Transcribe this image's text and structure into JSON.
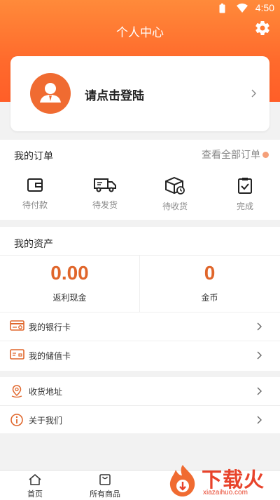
{
  "status_bar": {
    "time": "4:50"
  },
  "header": {
    "title": "个人中心",
    "settings_icon": "gear-icon"
  },
  "login_card": {
    "prompt": "请点击登陆",
    "avatar_icon": "user-avatar-icon",
    "chevron_icon": "chevron-right-icon"
  },
  "orders": {
    "title": "我的订单",
    "view_all": "查看全部订单",
    "items": [
      {
        "label": "待付款",
        "icon": "wallet-icon"
      },
      {
        "label": "待发货",
        "icon": "truck-icon"
      },
      {
        "label": "待收货",
        "icon": "package-icon"
      },
      {
        "label": "完成",
        "icon": "clipboard-check-icon"
      }
    ]
  },
  "assets": {
    "title": "我的资产",
    "cashback": {
      "value": "0.00",
      "label": "返利现金"
    },
    "coins": {
      "value": "0",
      "label": "金币"
    }
  },
  "menu": [
    {
      "label": "我的银行卡",
      "icon": "bank-card-icon"
    },
    {
      "label": "我的储值卡",
      "icon": "stored-value-card-icon"
    },
    {
      "label": "收货地址",
      "icon": "location-pin-icon"
    },
    {
      "label": "关于我们",
      "icon": "info-icon"
    }
  ],
  "tabbar": [
    {
      "label": "首页",
      "icon": "home-icon"
    },
    {
      "label": "所有商品",
      "icon": "shopping-bag-icon"
    }
  ],
  "watermark": {
    "brand": "下载火",
    "url": "xiazaihuo.com"
  },
  "colors": {
    "accent": "#ff6a2c",
    "value_orange": "#e0662b",
    "watermark_red": "#e8432b"
  }
}
